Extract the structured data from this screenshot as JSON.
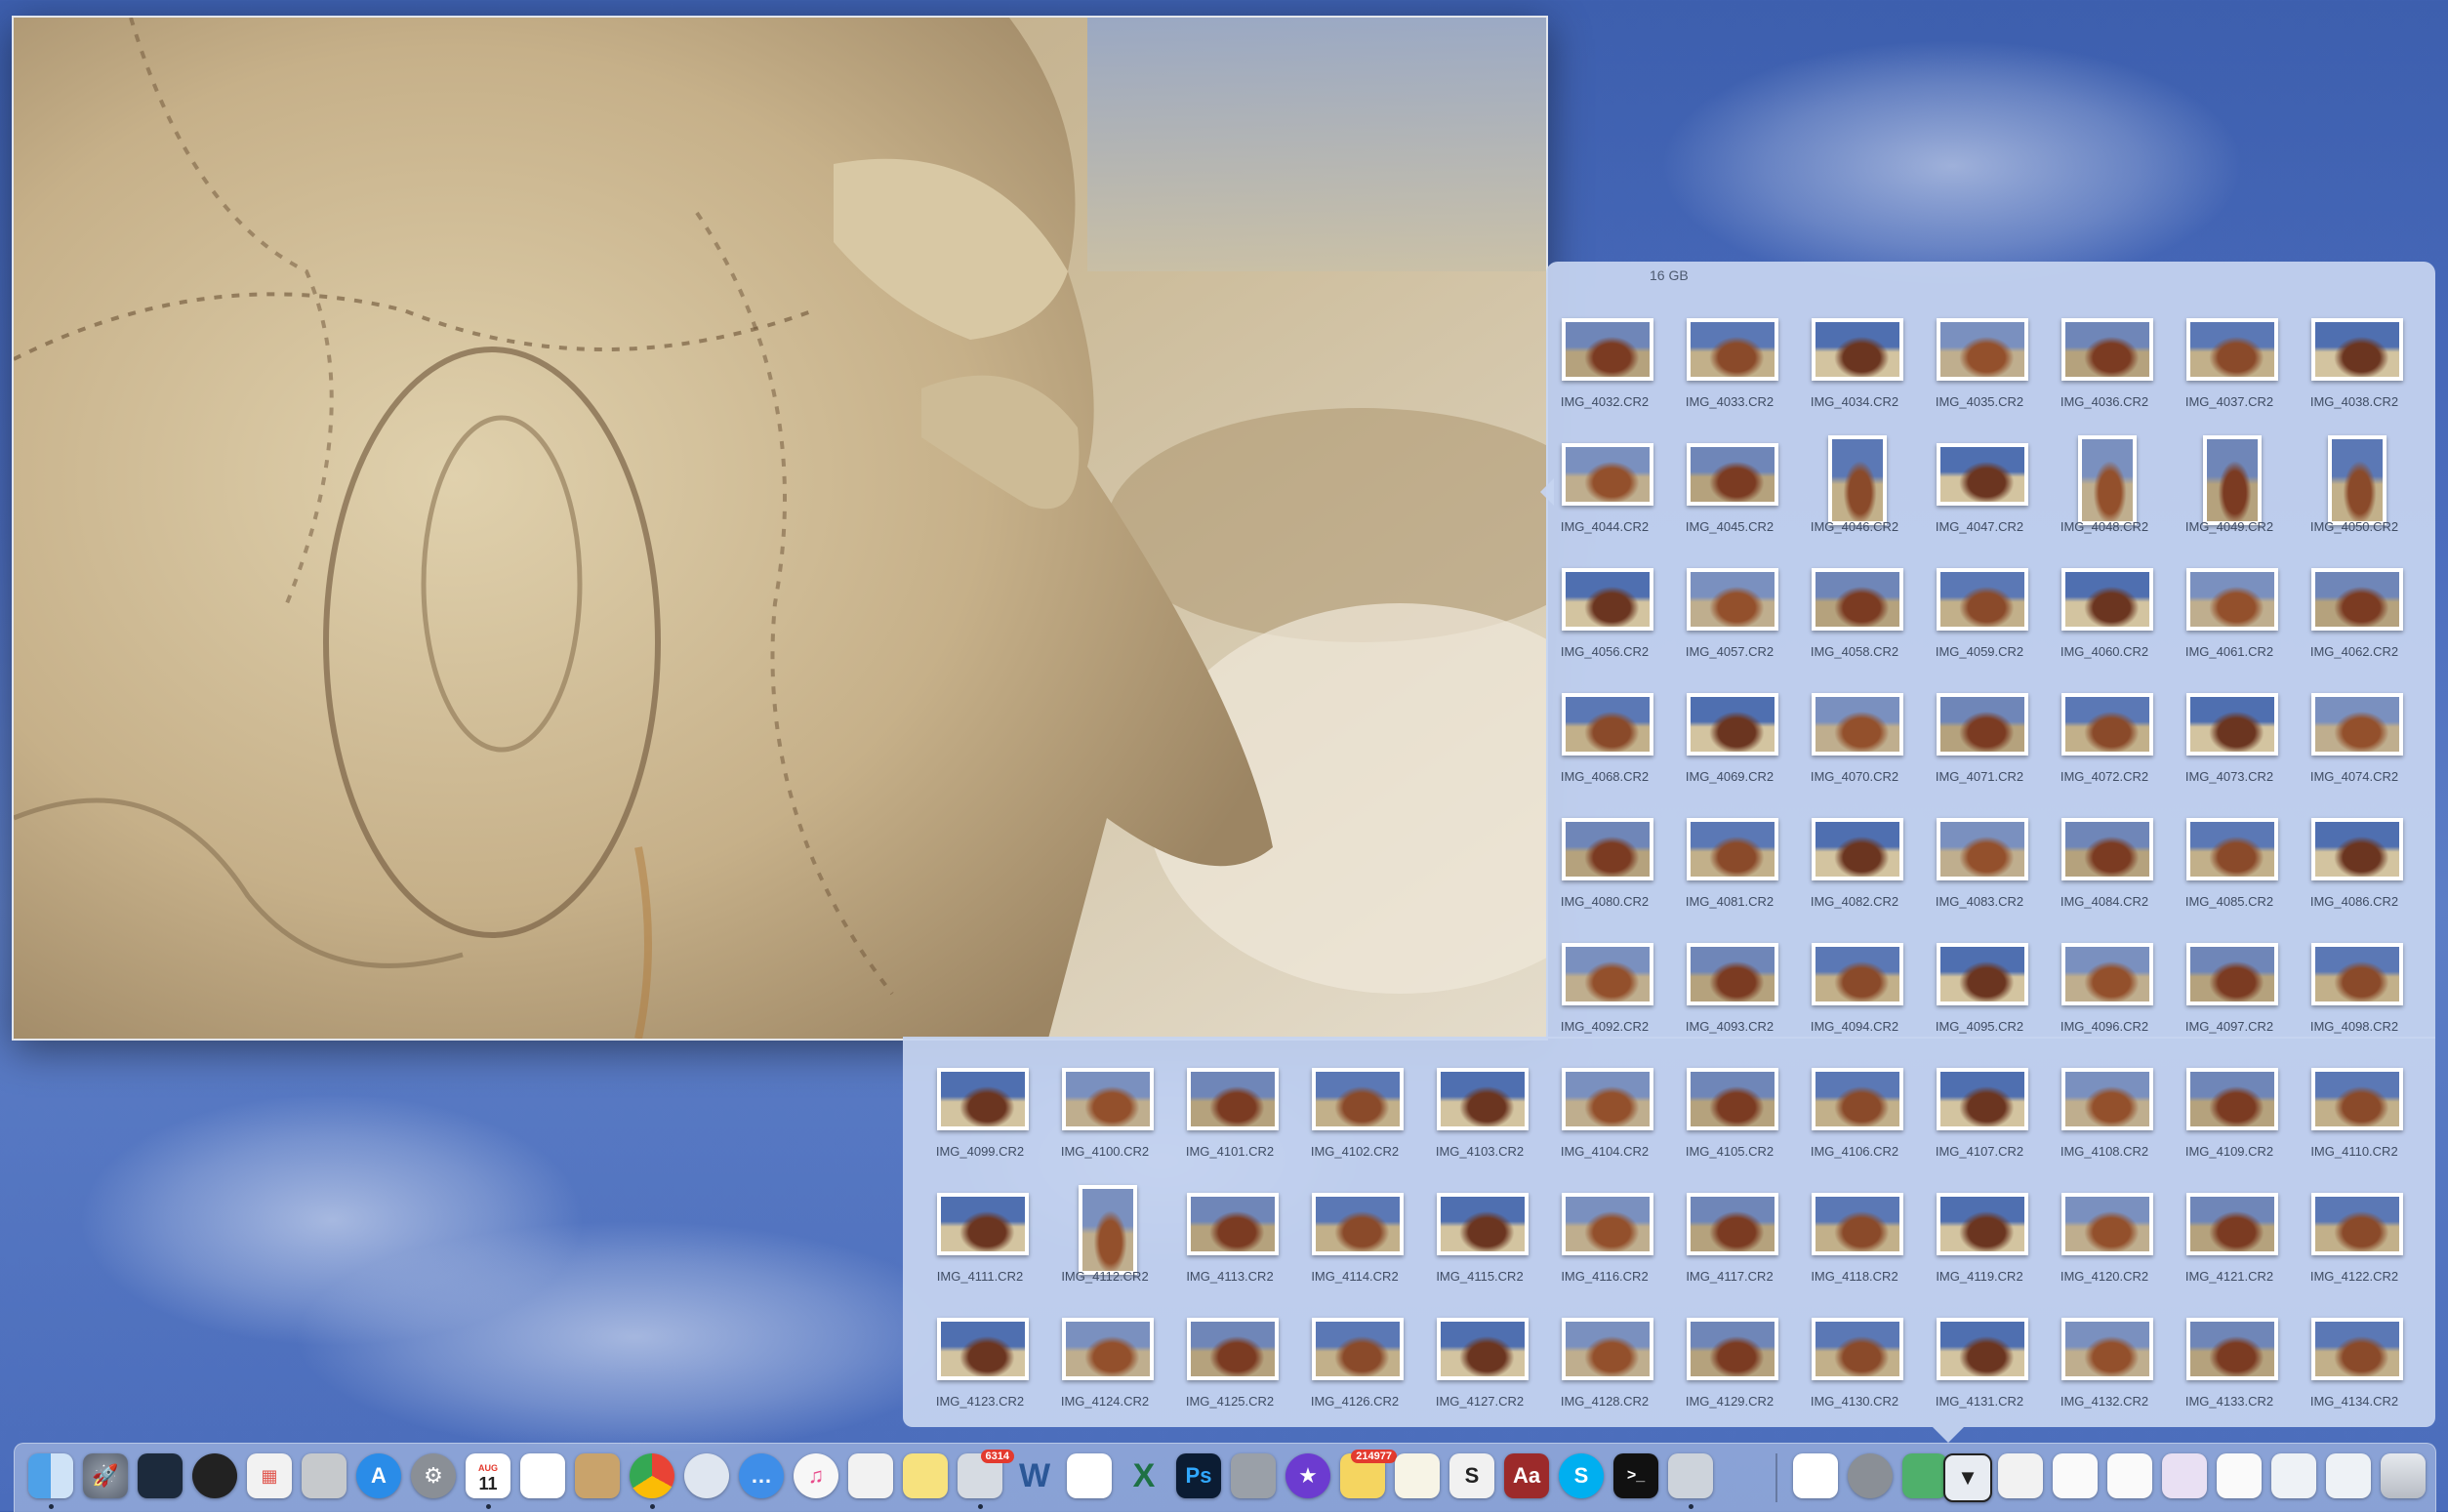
{
  "stack": {
    "caption": "16 GB",
    "files": [
      "IMG_4032.CR2",
      "IMG_4033.CR2",
      "IMG_4034.CR2",
      "IMG_4035.CR2",
      "IMG_4036.CR2",
      "IMG_4037.CR2",
      "IMG_4038.CR2",
      "IMG_4044.CR2",
      "IMG_4045.CR2",
      "IMG_4046.CR2",
      "IMG_4047.CR2",
      "IMG_4048.CR2",
      "IMG_4049.CR2",
      "IMG_4050.CR2",
      "IMG_4056.CR2",
      "IMG_4057.CR2",
      "IMG_4058.CR2",
      "IMG_4059.CR2",
      "IMG_4060.CR2",
      "IMG_4061.CR2",
      "IMG_4062.CR2",
      "IMG_4068.CR2",
      "IMG_4069.CR2",
      "IMG_4070.CR2",
      "IMG_4071.CR2",
      "IMG_4072.CR2",
      "IMG_4073.CR2",
      "IMG_4074.CR2",
      "IMG_4080.CR2",
      "IMG_4081.CR2",
      "IMG_4082.CR2",
      "IMG_4083.CR2",
      "IMG_4084.CR2",
      "IMG_4085.CR2",
      "IMG_4086.CR2",
      "IMG_4092.CR2",
      "IMG_4093.CR2",
      "IMG_4094.CR2",
      "IMG_4095.CR2",
      "IMG_4096.CR2",
      "IMG_4097.CR2",
      "IMG_4098.CR2",
      "IMG_4099.CR2",
      "IMG_4100.CR2",
      "IMG_4101.CR2",
      "IMG_4102.CR2",
      "IMG_4103.CR2",
      "IMG_4104.CR2",
      "IMG_4105.CR2",
      "IMG_4106.CR2",
      "IMG_4107.CR2",
      "IMG_4108.CR2",
      "IMG_4109.CR2",
      "IMG_4110.CR2",
      "IMG_4111.CR2",
      "IMG_4112.CR2",
      "IMG_4113.CR2",
      "IMG_4114.CR2",
      "IMG_4115.CR2",
      "IMG_4116.CR2",
      "IMG_4117.CR2",
      "IMG_4118.CR2",
      "IMG_4119.CR2",
      "IMG_4120.CR2",
      "IMG_4121.CR2",
      "IMG_4122.CR2",
      "IMG_4123.CR2",
      "IMG_4124.CR2",
      "IMG_4125.CR2",
      "IMG_4126.CR2",
      "IMG_4127.CR2",
      "IMG_4128.CR2",
      "IMG_4129.CR2",
      "IMG_4130.CR2",
      "IMG_4131.CR2",
      "IMG_4132.CR2",
      "IMG_4133.CR2",
      "IMG_4134.CR2"
    ],
    "portrait": [
      "IMG_4046.CR2",
      "IMG_4048.CR2",
      "IMG_4049.CR2",
      "IMG_4050.CR2",
      "IMG_4112.CR2"
    ]
  },
  "dock": {
    "calendar": {
      "month": "AUG",
      "day": "11"
    },
    "badges": {
      "preview": "6314",
      "mail": "214977"
    },
    "word_letter": "W",
    "excel_letter": "X",
    "photoshop_letter": "Ps",
    "scrivener_letter": "S",
    "dictionary_letter": "Aa",
    "skype_letter": "S",
    "terminal_glyph": ">_"
  }
}
